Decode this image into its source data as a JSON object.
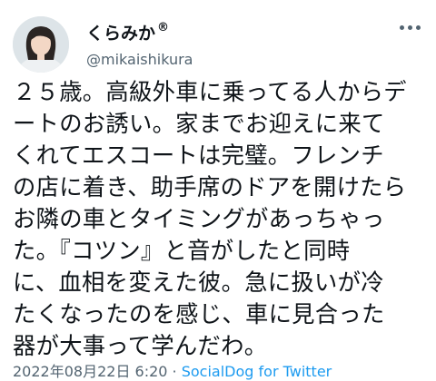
{
  "author": {
    "display_name": "くらみか",
    "badge": "®",
    "handle": "@mikaishikura"
  },
  "tweet": {
    "lines": [
      "２５歳。高級外車に乗ってる人からデ",
      "ートのお誘い。家までお迎えに来て",
      "くれてエスコートは完璧。フレンチ",
      "の店に着き、助手席のドアを開けたら",
      "お隣の車とタイミングがあっちゃっ",
      "た。『コツン』と音がしたと同時",
      "に、血相を変えた彼。急に扱いが冷",
      "たくなったのを感じ、車に見合った",
      "器が大事って学んだわ。"
    ],
    "date": "2022年08月22日 6:20",
    "separator": " · ",
    "source": "SocialDog for Twitter"
  },
  "icons": {
    "menu": "more-horizontal-icon",
    "avatar": "profile-photo"
  }
}
